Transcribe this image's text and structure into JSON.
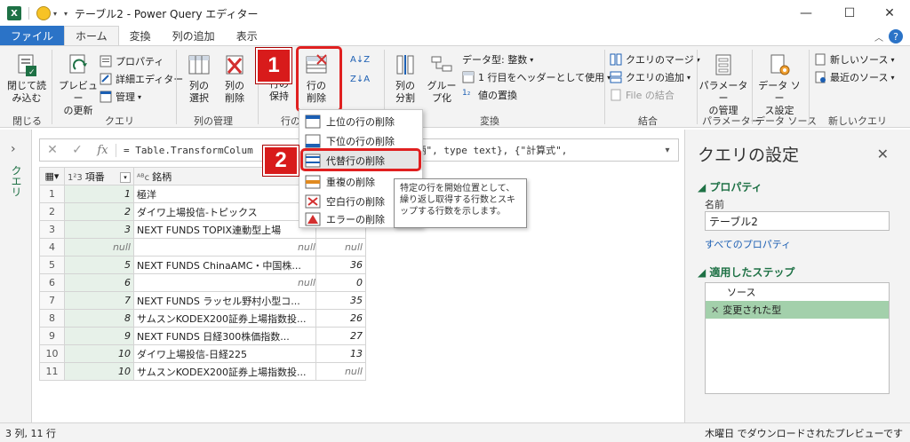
{
  "window": {
    "title": "テーブル2 - Power Query エディター",
    "minimize": "—",
    "maximize": "☐",
    "close": "✕"
  },
  "tabs": [
    "ファイル",
    "ホーム",
    "変換",
    "列の追加",
    "表示"
  ],
  "ribbon": {
    "close_load": "閉じて読\nみ込む",
    "close_group": "閉じる",
    "preview": "プレビュー\nの更新",
    "properties": "プロパティ",
    "advanced_editor": "詳細エディター",
    "manage": "管理",
    "query_group": "クエリ",
    "choose_cols": "列の\n選択",
    "remove_cols": "列の\n削除",
    "col_mgmt_group": "列の管理",
    "keep_rows": "行の\n保持",
    "remove_rows": "行の\n削除",
    "rows_group_partial": "行の",
    "split_col": "列の\n分割",
    "group_by": "グルー\nプ化",
    "data_type": "データ型: 整数",
    "first_row_header": "1 行目をヘッダーとして使用",
    "replace_values": "値の置換",
    "transform_group": "変換",
    "merge_queries": "クエリのマージ",
    "append_queries": "クエリの追加",
    "combine_files": "File の結合",
    "combine_group": "結合",
    "parameters": "パラメーター\nの管理",
    "params_group": "パラメーター",
    "data_source": "データ ソー\nス設定",
    "ds_group": "データ ソース",
    "new_source": "新しいソース",
    "recent_sources": "最近のソース",
    "new_query_group": "新しいクエリ",
    "callout1": "1",
    "callout2": "2"
  },
  "dropdown": {
    "items": [
      "上位の行の削除",
      "下位の行の削除",
      "代替行の削除",
      "重複の削除",
      "空白行の削除",
      "エラーの削除"
    ]
  },
  "tooltip": "特定の行を開始位置として、繰り返し取得する行数とスキップする行数を示します。",
  "formula": {
    "text": "= Table.TransformColum",
    "text_tail": "4.Type}, {\"銘柄\", type text}, {\"計算式\","
  },
  "nav": {
    "label": "クエリ"
  },
  "grid": {
    "headers": [
      "項番",
      "銘柄",
      ""
    ],
    "rows": [
      [
        "1",
        "1",
        "極洋",
        ""
      ],
      [
        "2",
        "2",
        "ダイワ上場投信-トピックス",
        ""
      ],
      [
        "3",
        "3",
        "NEXT FUNDS TOPIX連動型上場",
        ""
      ],
      [
        "4",
        "null",
        "null",
        "null"
      ],
      [
        "5",
        "5",
        "NEXT FUNDS ChinaAMC・中国株...",
        "36"
      ],
      [
        "6",
        "6",
        "null",
        "0"
      ],
      [
        "7",
        "7",
        "NEXT FUNDS ラッセル野村小型コ...",
        "35"
      ],
      [
        "8",
        "8",
        "サムスンKODEX200証券上場指数投...",
        "26"
      ],
      [
        "9",
        "9",
        "NEXT FUNDS 日経300株価指数...",
        "27"
      ],
      [
        "10",
        "10",
        "ダイワ上場投信-日経225",
        "13"
      ],
      [
        "11",
        "10",
        "サムスンKODEX200証券上場指数投...",
        "null"
      ]
    ]
  },
  "settings": {
    "title": "クエリの設定",
    "properties": "プロパティ",
    "name_label": "名前",
    "name_value": "テーブル2",
    "all_props": "すべてのプロパティ",
    "applied_steps": "適用したステップ",
    "steps": [
      "ソース",
      "変更された型"
    ]
  },
  "status": {
    "left": "3 列, 11 行",
    "right": "木曜日 でダウンロードされたプレビューです"
  }
}
